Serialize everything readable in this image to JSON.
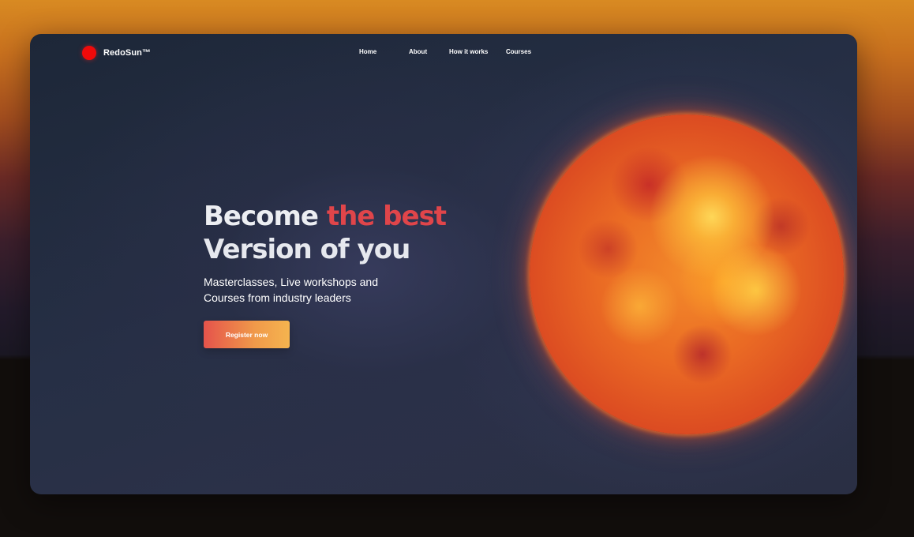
{
  "brand": {
    "name": "RedoSun™",
    "dot_color": "#f00a0a"
  },
  "nav": {
    "items": [
      {
        "label": "Home"
      },
      {
        "label": "About"
      },
      {
        "label": "How it works"
      },
      {
        "label": "Courses"
      }
    ]
  },
  "hero": {
    "headline_part1": "Become ",
    "headline_accent": "the best",
    "headline_line2": "Version of you",
    "subtitle": "Masterclasses, Live workshops and Courses from industry leaders",
    "cta_label": "Register now",
    "accent_color": "#e0454a"
  },
  "visual": {
    "icon": "sun-illustration"
  }
}
